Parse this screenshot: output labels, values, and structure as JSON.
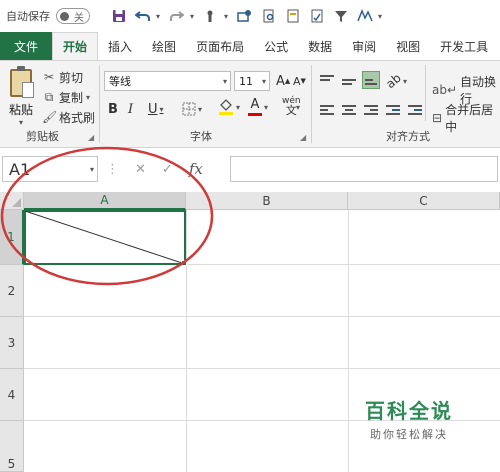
{
  "quick_access": {
    "autosave_label": "自动保存",
    "autosave_state": "关",
    "icons": [
      "save-icon",
      "undo-icon",
      "redo-icon",
      "touch-mode-icon",
      "share-icon",
      "print-preview-icon",
      "document-icon",
      "spellcheck-icon",
      "filter-icon",
      "ink-icon"
    ]
  },
  "tabs": [
    "文件",
    "开始",
    "插入",
    "绘图",
    "页面布局",
    "公式",
    "数据",
    "审阅",
    "视图",
    "开发工具"
  ],
  "active_tab": "开始",
  "ribbon": {
    "clipboard": {
      "paste_label": "粘贴",
      "cut_label": "剪切",
      "copy_label": "复制",
      "format_painter_label": "格式刷",
      "group_label": "剪贴板"
    },
    "font": {
      "font_name": "等线",
      "font_size": "11",
      "grow_label": "A",
      "shrink_label": "A",
      "bold": "B",
      "italic": "I",
      "underline": "U",
      "font_color_label": "A",
      "phonetic_label": "wén",
      "group_label": "字体"
    },
    "alignment": {
      "wrap_text_label": "自动换行",
      "merge_center_label": "合并后居中",
      "group_label": "对齐方式"
    }
  },
  "formula_bar": {
    "name_box": "A1",
    "fx_label": "fx",
    "cancel_icon": "✕",
    "enter_icon": "✓",
    "formula": ""
  },
  "sheet": {
    "columns": [
      "A",
      "B",
      "C"
    ],
    "rows": [
      "1",
      "2",
      "3",
      "4",
      "5"
    ],
    "active_cell": "A1"
  },
  "watermark": {
    "title": "百科全说",
    "subtitle": "助你轻松解决"
  },
  "colors": {
    "excel_green": "#217346",
    "annotation_red": "#d03a3a"
  }
}
